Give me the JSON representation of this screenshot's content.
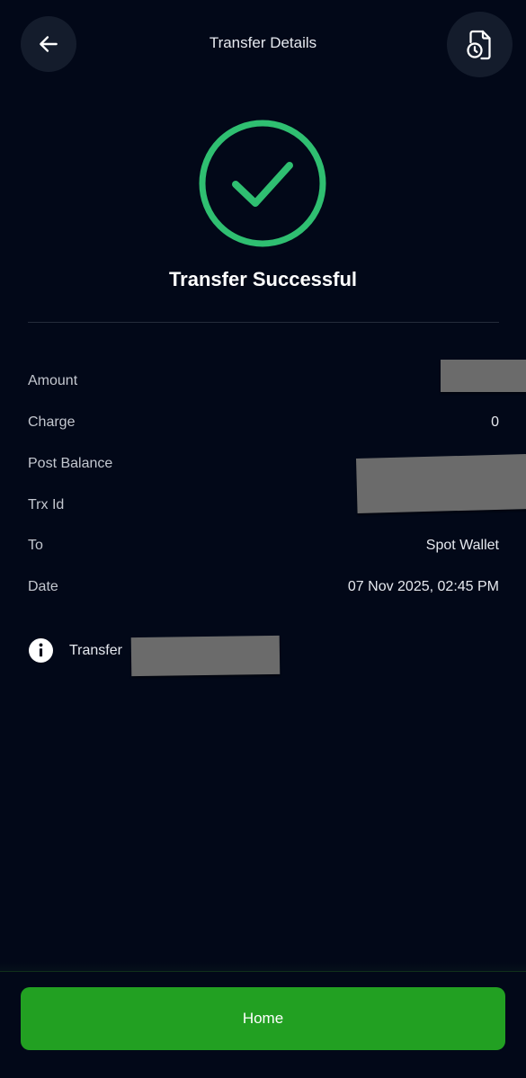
{
  "header": {
    "title": "Transfer Details",
    "back_icon": "arrow-left-icon",
    "history_icon": "document-clock-icon"
  },
  "status": {
    "title": "Transfer Successful",
    "icon": "check-circle-icon",
    "color": "#2fbf71"
  },
  "details": [
    {
      "label": "Amount",
      "value": ""
    },
    {
      "label": "Charge",
      "value": "0"
    },
    {
      "label": "Post Balance",
      "value": ""
    },
    {
      "label": "Trx Id",
      "value": ""
    },
    {
      "label": "To",
      "value": "Spot Wallet"
    },
    {
      "label": "Date",
      "value": "07 Nov 2025, 02:45 PM"
    }
  ],
  "note": {
    "icon": "info-icon",
    "text": "Transfer"
  },
  "footer": {
    "home_label": "Home",
    "button_color": "#22a022"
  }
}
